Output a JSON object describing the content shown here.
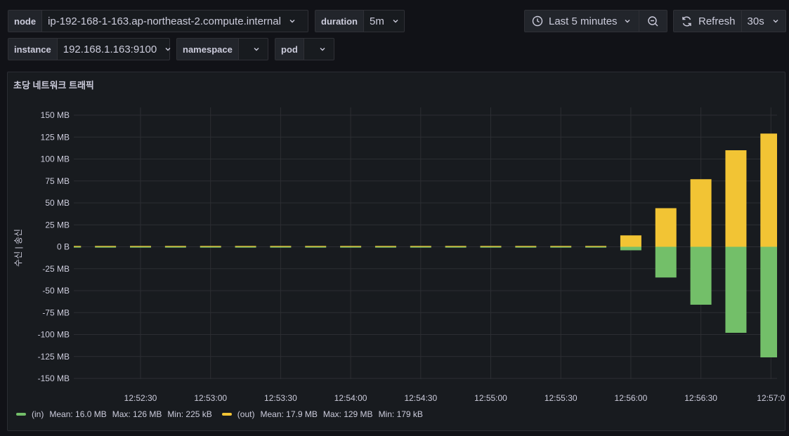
{
  "variables": {
    "node": {
      "label": "node",
      "value": "ip-192-168-1-163.ap-northeast-2.compute.internal"
    },
    "duration": {
      "label": "duration",
      "value": "5m"
    },
    "instance": {
      "label": "instance",
      "value": "192.168.1.163:9100"
    },
    "namespace": {
      "label": "namespace",
      "value": ""
    },
    "pod": {
      "label": "pod",
      "value": ""
    }
  },
  "toolbar": {
    "time_range": "Last 5 minutes",
    "refresh_label": "Refresh",
    "refresh_interval": "30s"
  },
  "panel": {
    "title": "초당 네트워크 트래픽"
  },
  "legend": {
    "in": {
      "name": "(in)",
      "mean": "Mean: 16.0 MB",
      "max": "Max: 126 MB",
      "min": "Min: 225 kB"
    },
    "out": {
      "name": "(out)",
      "mean": "Mean: 17.9 MB",
      "max": "Max: 129 MB",
      "min": "Min: 179 kB"
    }
  },
  "colors": {
    "in": "#73bf69",
    "out": "#f2c434",
    "grid": "#2c2e33"
  },
  "chart_data": {
    "type": "bar",
    "ylabel": "수신 | 송신",
    "ylim": [
      -150,
      150
    ],
    "yticks": [
      150,
      125,
      100,
      75,
      50,
      25,
      0,
      -25,
      -50,
      -75,
      -100,
      -125,
      -150
    ],
    "ytick_labels": [
      "150 MB",
      "125 MB",
      "100 MB",
      "75 MB",
      "50 MB",
      "25 MB",
      "0 B",
      "-25 MB",
      "-50 MB",
      "-75 MB",
      "-100 MB",
      "-125 MB",
      "-150 MB"
    ],
    "x_tick_labels": [
      "12:52:30",
      "12:53:00",
      "12:53:30",
      "12:54:00",
      "12:54:30",
      "12:55:00",
      "12:55:30",
      "12:56:00",
      "12:56:30",
      "12:57:0"
    ],
    "x_seconds": [
      0,
      15,
      30,
      45,
      60,
      75,
      90,
      105,
      120,
      135,
      150,
      165,
      180,
      195,
      210,
      225,
      240,
      255,
      270,
      285,
      300
    ],
    "series": [
      {
        "name": "(out)",
        "values": [
          0.2,
          0.2,
          0.2,
          0.2,
          0.2,
          0.2,
          0.2,
          0.2,
          0.2,
          0.2,
          0.2,
          0.2,
          0.2,
          0.2,
          0.2,
          0.2,
          13,
          44,
          77,
          110,
          129
        ]
      },
      {
        "name": "(in)",
        "values": [
          -0.2,
          -0.2,
          -0.2,
          -0.2,
          -0.2,
          -0.2,
          -0.2,
          -0.2,
          -0.2,
          -0.2,
          -0.2,
          -0.2,
          -0.2,
          -0.2,
          -0.2,
          -0.2,
          -4,
          -35,
          -66,
          -98,
          -126
        ]
      }
    ]
  }
}
